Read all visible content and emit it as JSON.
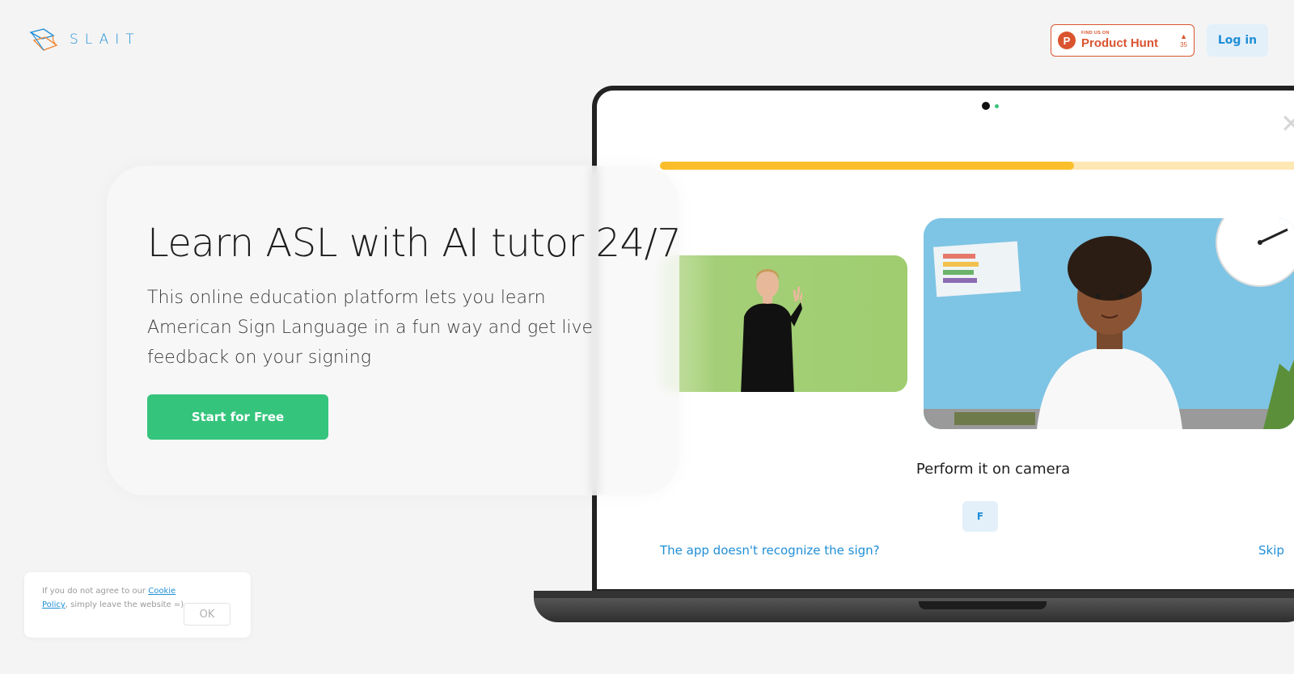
{
  "header": {
    "logo_text": "SLAIT",
    "product_hunt": {
      "small_text": "FIND US ON",
      "big_text": "Product Hunt",
      "letter": "P",
      "votes": "35"
    },
    "login_label": "Log in"
  },
  "hero": {
    "title": "Learn ASL with AI tutor 24/7",
    "subtitle": "This online education platform lets you learn American Sign Language in a fun way and get live feedback on your signing",
    "cta_label": "Start for Free"
  },
  "demo": {
    "progress": 0.61,
    "prompt": "Perform it on camera",
    "sign_label": "F",
    "help_link": "The app doesn't recognize the sign?",
    "skip_link": "Skip"
  },
  "cookie": {
    "text_before": "If you do not agree to our ",
    "link_text": "Cookie Policy",
    "text_after": ", simply leave the website =)",
    "ok_label": "OK"
  },
  "colors": {
    "brand_blue": "#1f8fd6",
    "cta_green": "#35c47c",
    "progress_yellow": "#fbbf2b",
    "product_hunt_orange": "#da552f"
  }
}
